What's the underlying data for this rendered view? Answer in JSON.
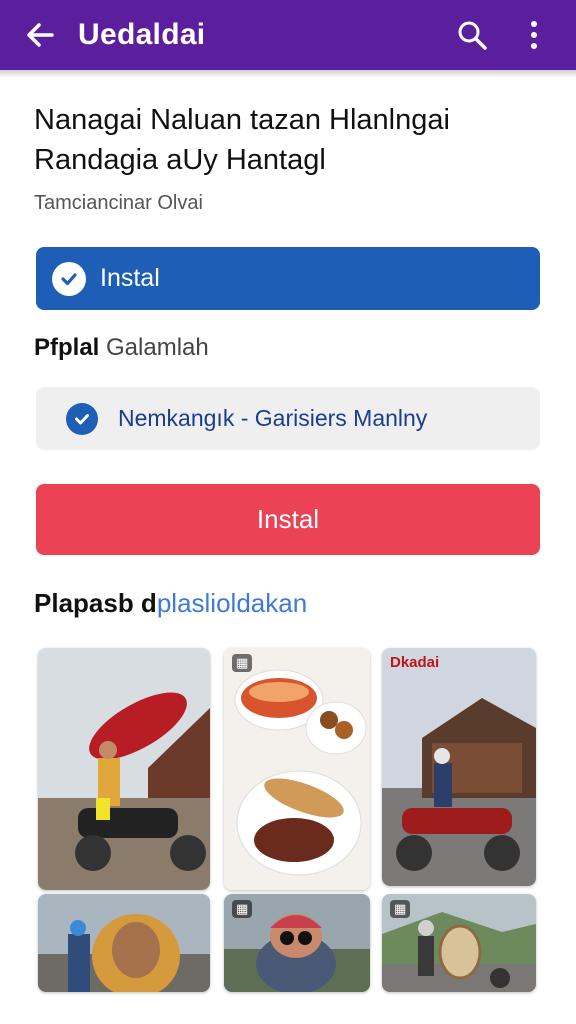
{
  "appbar": {
    "title": "Uedaldai",
    "back_icon": "arrow-left-icon",
    "search_icon": "search-icon",
    "menu_icon": "more-vert-icon",
    "color": "#5b1f9e"
  },
  "content": {
    "headline": "Nanagai Naluan tazan Hlanlngai Randagia aUy Hantagl",
    "subtitle": "Tamciancinar Olvai"
  },
  "primary_button": {
    "label": "Instal",
    "icon": "check-circle-icon",
    "color": "#1e5eb6"
  },
  "section1": {
    "bold": "Pfplal",
    "rest": " Galamlah"
  },
  "selected_option": {
    "label": "Nemkangık - Garisiers Manlny",
    "icon": "check-circle-icon"
  },
  "danger_button": {
    "label": "Instal",
    "color": "#eb4255"
  },
  "section2": {
    "bold": "Plapasb d",
    "blue": "plaslioldakan"
  },
  "gallery": {
    "images": [
      {
        "description": "motorcycle-rider-with-boat"
      },
      {
        "description": "food-platter"
      },
      {
        "description": "poster-motorcycle-street",
        "poster_text": "Dkadai"
      },
      {
        "description": "elderly-woman-portrait"
      },
      {
        "description": "child-with-helmet"
      },
      {
        "description": "rider-with-shield"
      }
    ],
    "badge_icon": "gallery-icon"
  }
}
